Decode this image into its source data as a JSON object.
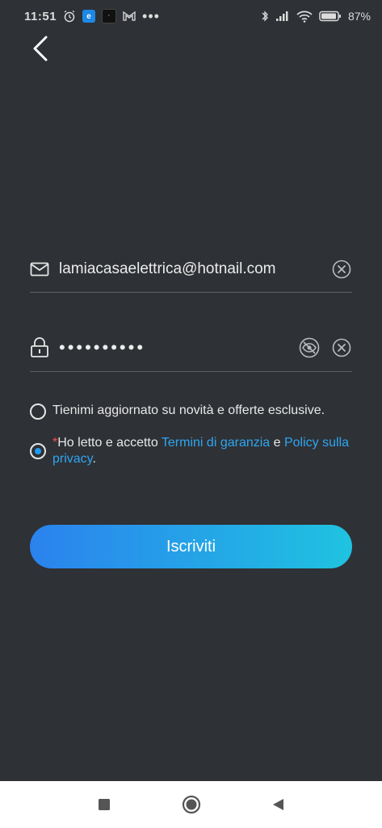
{
  "status_bar": {
    "time": "11:51",
    "app_badge_e": "e",
    "app_badge_dark": "·",
    "more": "•••",
    "battery_percent": "87%"
  },
  "form": {
    "email_value": "lamiacasaelettrica@hotnail.com",
    "password_value": "••••••••••"
  },
  "checks": {
    "newsletter": {
      "text": "Tienimi aggiornato su novità e offerte esclusive.",
      "checked": false
    },
    "terms": {
      "required_mark": "*",
      "text_before": "Ho letto e accetto ",
      "link_warranty": "Termini di garanzia",
      "text_and": " e ",
      "link_privacy": "Policy sulla privacy",
      "text_end": ".",
      "checked": true
    }
  },
  "signup_button": {
    "label": "Iscriviti"
  },
  "colors": {
    "background": "#2e3135",
    "accent_start": "#2b82ee",
    "accent_end": "#1fc3e0",
    "link": "#2ea6f2",
    "required": "#ff4d4d"
  },
  "icons": {
    "back": "chevron-left-icon",
    "email": "envelope-icon",
    "password": "lock-icon",
    "clear": "clear-circle-icon",
    "visibility": "eye-off-icon"
  }
}
